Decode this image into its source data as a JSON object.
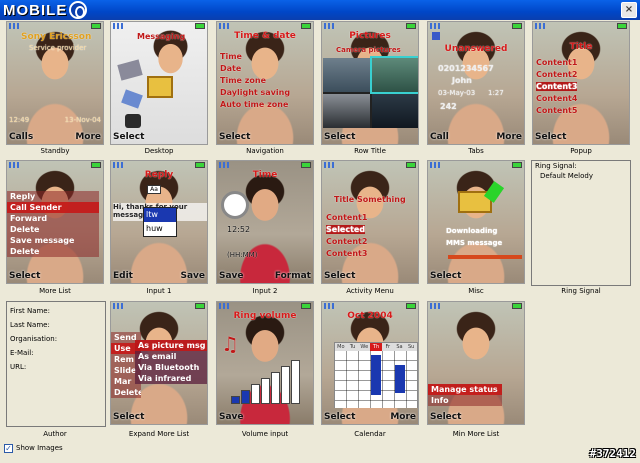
{
  "app": {
    "logo_text": "MOBILE",
    "close_glyph": "×",
    "watermark": "#372412"
  },
  "standby": {
    "caption": "Standby",
    "title": "Sony Ericsson",
    "subtitle": "Service provider",
    "time": "12:49",
    "date": "13-Nov-04",
    "left_key": "Calls",
    "right_key": "More"
  },
  "desktop": {
    "caption": "Desktop",
    "title": "Messaging",
    "left_key": "Select"
  },
  "navigation": {
    "caption": "Navigation",
    "title": "Time & date",
    "items": [
      "Time",
      "Date",
      "Time zone",
      "Daylight saving",
      "Auto time zone"
    ],
    "left_key": "Select"
  },
  "rowtitle": {
    "caption": "Row Title",
    "title": "Pictures",
    "subtitle": "Camera pictures",
    "left_key": "Select"
  },
  "tabs": {
    "caption": "Tabs",
    "title": "Unanswered",
    "number": "0201234567",
    "name": "John",
    "date": "03-May-03",
    "time": "1:27",
    "count": "242",
    "left_key": "Call",
    "right_key": "More"
  },
  "popup": {
    "caption": "Popup",
    "title": "Title",
    "items": [
      "Content1",
      "Content2",
      "Content3",
      "Content4",
      "Content5"
    ],
    "left_key": "Select"
  },
  "morelist": {
    "caption": "More List",
    "items": [
      "Reply",
      "Call Sender",
      "Forward",
      "Delete",
      "Save message",
      "Delete"
    ],
    "left_key": "Select"
  },
  "input1": {
    "caption": "Input 1",
    "title": "Reply",
    "body": "Hi, thanks for your message",
    "mode": "Aa",
    "suggestions": [
      "ltw",
      "huw"
    ],
    "left_key": "Edit",
    "right_key": "Save"
  },
  "input2": {
    "caption": "Input 2",
    "title": "Time",
    "time": "12:52",
    "format": "(HH:MM)",
    "left_key": "Save",
    "right_key": "Format"
  },
  "activity": {
    "caption": "Activity Menu",
    "title": "Title Something",
    "items": [
      "Content1",
      "Selected",
      "Content2",
      "Content3"
    ],
    "left_key": "Select"
  },
  "misc": {
    "caption": "Misc",
    "text1": "Downloading",
    "text2": "MMS message",
    "left_key": "Select"
  },
  "ringsignal": {
    "caption": "Ring Signal",
    "label": "Ring Signal:",
    "value": "Default Melody"
  },
  "author": {
    "caption": "Author",
    "fields": [
      "First Name:",
      "Last Name:",
      "Organisation:",
      "E-Mail:",
      "URL:"
    ]
  },
  "expand": {
    "caption": "Expand More List",
    "title": "Send picture",
    "items": [
      "Send",
      "Use",
      "Rem",
      "Slide",
      "Mar",
      "Delete"
    ],
    "submenu": [
      "As picture msg",
      "As email",
      "Via Bluetooth",
      "Via infrared"
    ],
    "left_key": "Select"
  },
  "volume": {
    "caption": "Volume input",
    "title": "Ring volume",
    "level_fraction": 0.57,
    "left_key": "Save"
  },
  "calendar": {
    "caption": "Calendar",
    "title": "Oct 2004",
    "days": [
      "Mo",
      "Tu",
      "We",
      "Th",
      "Fr",
      "Sa",
      "Su"
    ],
    "left_key": "Select",
    "right_key": "More"
  },
  "minmore": {
    "caption": "Min More List",
    "items": [
      "Manage status",
      "Info"
    ],
    "left_key": "Select"
  },
  "footer": {
    "show_images_label": "Show Images",
    "show_images_checked": "✓"
  }
}
